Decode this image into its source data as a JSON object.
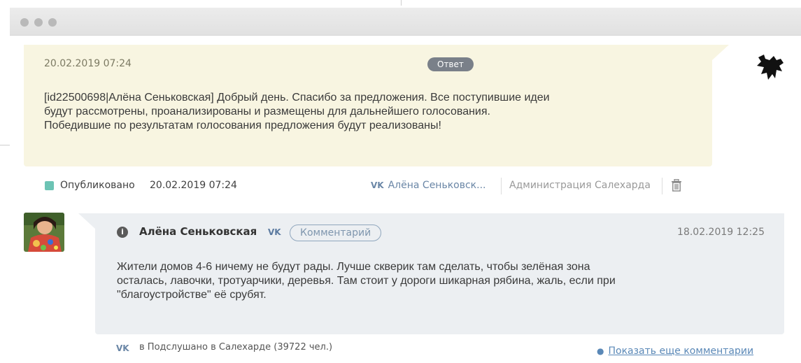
{
  "reply": {
    "date": "20.02.2019 07:24",
    "badge": "Ответ",
    "lines": [
      "[id22500698|Алёна Сеньковская] Добрый день. Спасибо за предложения. Все поступившие идеи",
      "будут рассмотрены, проанализированы и размещены для дальнейшего голосования.",
      "Победившие по результатам голосования предложения будут реализованы!"
    ]
  },
  "status": {
    "label": "Опубликовано",
    "date": "20.02.2019 07:24",
    "vk_icon": "VK",
    "author": "Алёна Сеньковск...",
    "admin": "Администрация Салехарда"
  },
  "comment": {
    "author": "Алёна Сеньковская",
    "vk_icon": "VK",
    "badge": "Комментарий",
    "date": "18.02.2019 12:25",
    "lines": [
      "Жители домов 4-6 ничему не будут рады. Лучше скверик там сделать, чтобы зелёная зона",
      "осталась, лавочки, тротуарчики, деревья. Там стоит у дороги шикарная рябина, жаль, если при",
      "\"благоустройстве\" её срубят."
    ]
  },
  "footer": {
    "vk_icon": "VK",
    "source": "в Подслушано в Салехарде (39722 чел.)",
    "more": "Показать еще комментарии"
  },
  "colors": {
    "reply_bg": "#f8f5e1",
    "comment_bg": "#eceff2",
    "status_green": "#6cc3b4",
    "vk_blue": "#6a86a6",
    "link_blue": "#5a88b7"
  }
}
